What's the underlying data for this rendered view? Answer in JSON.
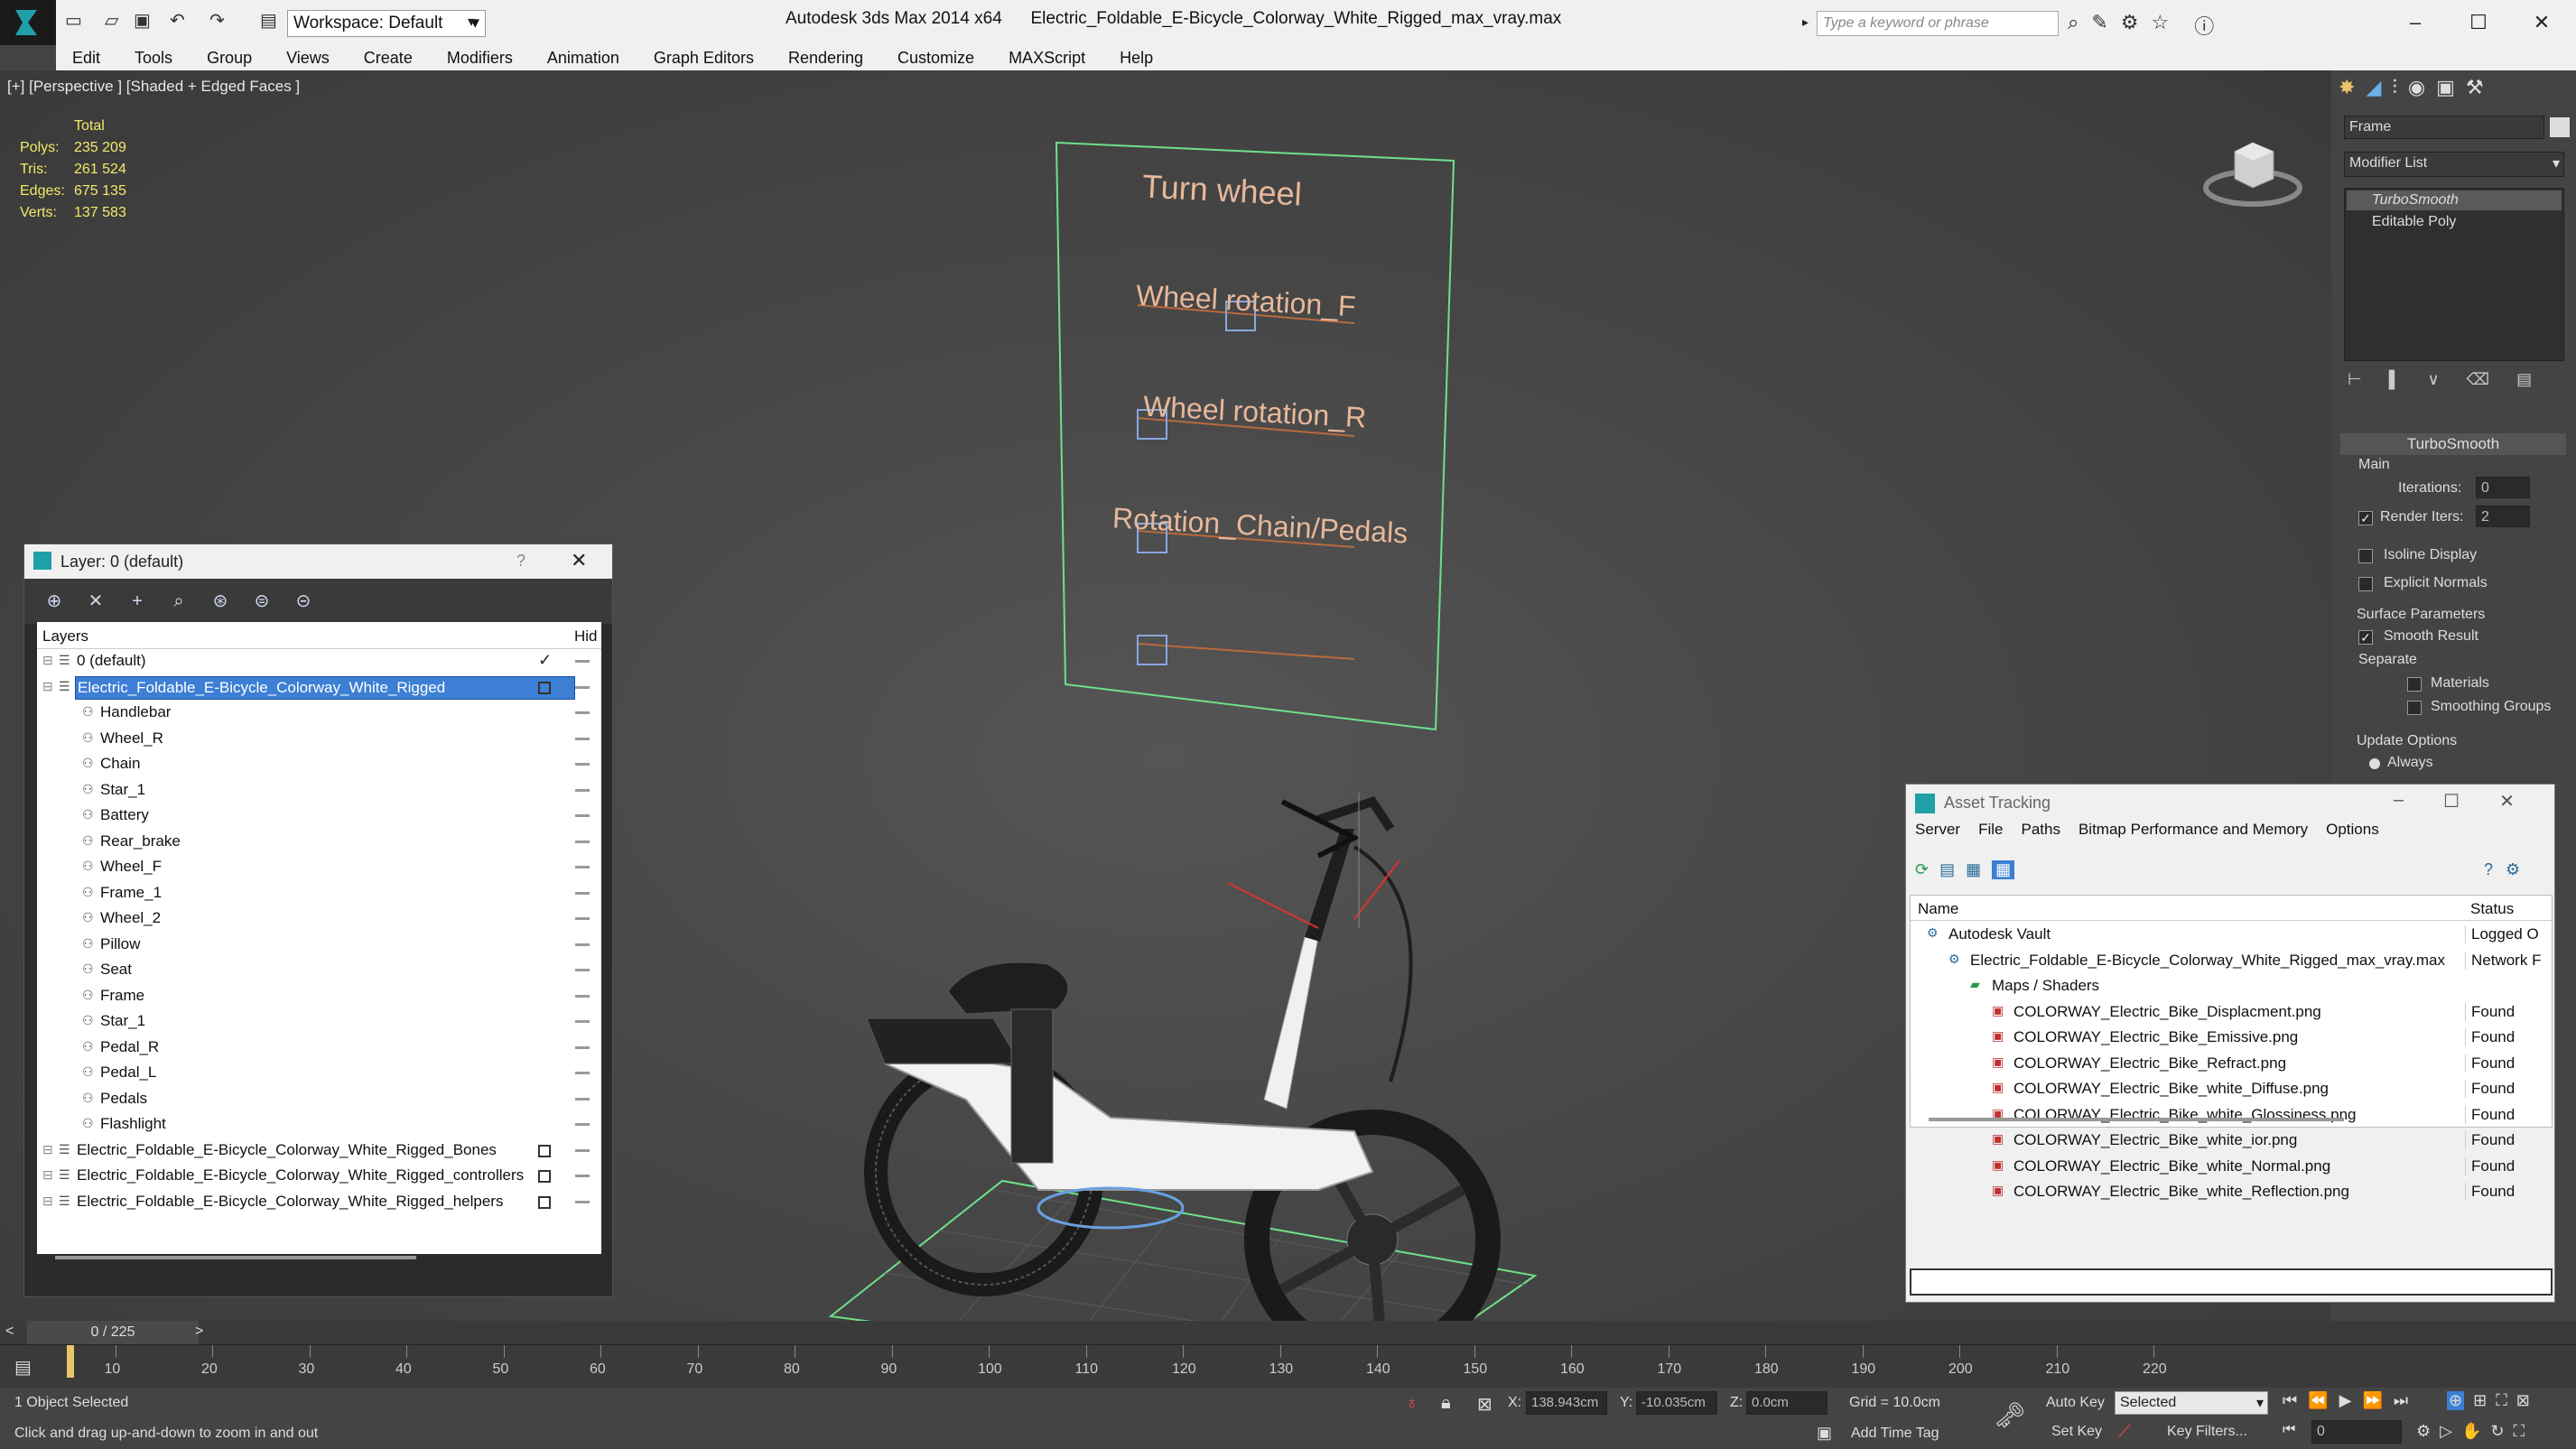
{
  "titlebar": {
    "workspace": "Workspace: Default",
    "app_title": "Autodesk 3ds Max  2014 x64",
    "file_title": "Electric_Foldable_E-Bicycle_Colorway_White_Rigged_max_vray.max",
    "search_placeholder": "Type a keyword or phrase"
  },
  "menu": [
    "Edit",
    "Tools",
    "Group",
    "Views",
    "Create",
    "Modifiers",
    "Animation",
    "Graph Editors",
    "Rendering",
    "Customize",
    "MAXScript",
    "Help"
  ],
  "viewport": {
    "label": "[+] [Perspective ] [Shaded + Edged Faces ]",
    "stats": {
      "header": "Total",
      "rows": [
        {
          "k": "Polys:",
          "v": "235 209"
        },
        {
          "k": "Tris:",
          "v": "261 524"
        },
        {
          "k": "Edges:",
          "v": "675 135"
        },
        {
          "k": "Verts:",
          "v": "137 583"
        }
      ]
    },
    "controller_labels": [
      "Turn wheel",
      "Wheel rotation_F",
      "Wheel rotation_R",
      "Rotation_Chain/Pedals"
    ]
  },
  "layer_window": {
    "title": "Layer: 0 (default)",
    "help": "?",
    "col_layers": "Layers",
    "col_hide": "Hid",
    "rows": [
      {
        "label": "0 (default)",
        "level": 1,
        "check": true
      },
      {
        "label": "Electric_Foldable_E-Bicycle_Colorway_White_Rigged",
        "level": 1,
        "selected": true,
        "box": true
      },
      {
        "label": "Handlebar",
        "level": 2
      },
      {
        "label": "Wheel_R",
        "level": 2
      },
      {
        "label": "Chain",
        "level": 2
      },
      {
        "label": "Star_1",
        "level": 2
      },
      {
        "label": "Battery",
        "level": 2
      },
      {
        "label": "Rear_brake",
        "level": 2
      },
      {
        "label": "Wheel_F",
        "level": 2
      },
      {
        "label": "Frame_1",
        "level": 2
      },
      {
        "label": "Wheel_2",
        "level": 2
      },
      {
        "label": "Pillow",
        "level": 2
      },
      {
        "label": "Seat",
        "level": 2
      },
      {
        "label": "Frame",
        "level": 2
      },
      {
        "label": "Star_1",
        "level": 2
      },
      {
        "label": "Pedal_R",
        "level": 2
      },
      {
        "label": "Pedal_L",
        "level": 2
      },
      {
        "label": "Pedals",
        "level": 2
      },
      {
        "label": "Flashlight",
        "level": 2
      },
      {
        "label": "Electric_Foldable_E-Bicycle_Colorway_White_Rigged_Bones",
        "level": 1,
        "box": true
      },
      {
        "label": "Electric_Foldable_E-Bicycle_Colorway_White_Rigged_controllers",
        "level": 1,
        "box": true
      },
      {
        "label": "Electric_Foldable_E-Bicycle_Colorway_White_Rigged_helpers",
        "level": 1,
        "box": true
      }
    ]
  },
  "command_panel": {
    "object_name": "Frame",
    "modifier_list": "Modifier List",
    "stack": [
      "TurboSmooth",
      "Editable Poly"
    ],
    "rollout_title": "TurboSmooth",
    "main_group": "Main",
    "iterations_label": "Iterations:",
    "iterations_value": "0",
    "render_iters_label": "Render Iters:",
    "render_iters_value": "2",
    "isoline": "Isoline Display",
    "explicit_normals": "Explicit Normals",
    "surface_params": "Surface Parameters",
    "smooth_result": "Smooth Result",
    "separate": "Separate",
    "materials": "Materials",
    "smoothing_groups": "Smoothing Groups",
    "update_options": "Update Options",
    "always": "Always"
  },
  "asset_tracking": {
    "title": "Asset Tracking",
    "menu": [
      "Server",
      "File",
      "Paths",
      "Bitmap Performance and Memory",
      "Options"
    ],
    "col_name": "Name",
    "col_status": "Status",
    "rows": [
      {
        "name": "Autodesk Vault",
        "status": "Logged O",
        "level": 1
      },
      {
        "name": "Electric_Foldable_E-Bicycle_Colorway_White_Rigged_max_vray.max",
        "status": "Network F",
        "level": 2
      },
      {
        "name": "Maps / Shaders",
        "status": "",
        "level": 3
      },
      {
        "name": "COLORWAY_Electric_Bike_Displacment.png",
        "status": "Found",
        "level": 4
      },
      {
        "name": "COLORWAY_Electric_Bike_Emissive.png",
        "status": "Found",
        "level": 4
      },
      {
        "name": "COLORWAY_Electric_Bike_Refract.png",
        "status": "Found",
        "level": 4
      },
      {
        "name": "COLORWAY_Electric_Bike_white_Diffuse.png",
        "status": "Found",
        "level": 4
      },
      {
        "name": "COLORWAY_Electric_Bike_white_Glossiness.png",
        "status": "Found",
        "level": 4
      },
      {
        "name": "COLORWAY_Electric_Bike_white_ior.png",
        "status": "Found",
        "level": 4
      },
      {
        "name": "COLORWAY_Electric_Bike_white_Normal.png",
        "status": "Found",
        "level": 4
      },
      {
        "name": "COLORWAY_Electric_Bike_white_Reflection.png",
        "status": "Found",
        "level": 4
      }
    ]
  },
  "timeline": {
    "frame": "0 / 225",
    "ticks": [
      "10",
      "20",
      "30",
      "40",
      "50",
      "60",
      "70",
      "80",
      "90",
      "100",
      "110",
      "120",
      "130",
      "140",
      "150",
      "160",
      "170",
      "180",
      "190",
      "200",
      "210",
      "220"
    ]
  },
  "status": {
    "selected": "1 Object Selected",
    "prompt": "Click and drag up-and-down to zoom in and out",
    "x_label": "X:",
    "x_value": "138.943cm",
    "y_label": "Y:",
    "y_value": "-10.035cm",
    "z_label": "Z:",
    "z_value": "0.0cm",
    "grid": "Grid = 10.0cm",
    "add_time_tag": "Add Time Tag",
    "auto_key": "Auto Key",
    "set_key": "Set Key",
    "selected_dropdown": "Selected",
    "key_filters": "Key Filters...",
    "frame_value": "0"
  },
  "colors": {
    "viewport_bg": "#444444",
    "selection_blue": "#3c7fd4",
    "stats_yellow": "#f2e96a",
    "controller_text": "#e8b89a",
    "grid_green": "#6ee08a"
  }
}
